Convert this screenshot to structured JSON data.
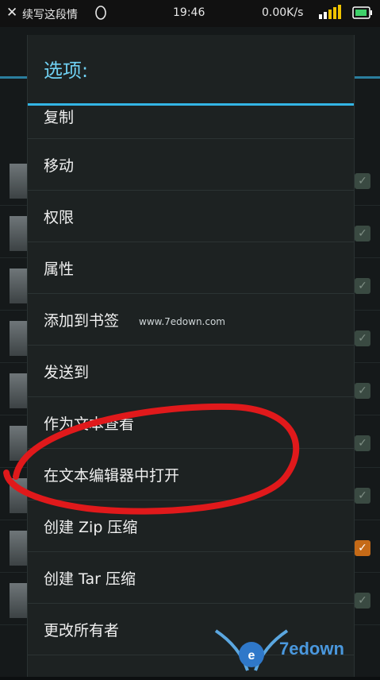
{
  "status_bar": {
    "notification_text": "续写这段情",
    "time": "19:46",
    "speed": "0.00K/s"
  },
  "dialog": {
    "title": "选项:",
    "items": [
      {
        "label": "复制"
      },
      {
        "label": "移动"
      },
      {
        "label": "权限"
      },
      {
        "label": "属性"
      },
      {
        "label": "添加到书签"
      },
      {
        "label": "发送到"
      },
      {
        "label": "作为文本查看"
      },
      {
        "label": "在文本编辑器中打开"
      },
      {
        "label": "创建 Zip 压缩"
      },
      {
        "label": "创建 Tar 压缩"
      },
      {
        "label": "更改所有者"
      }
    ]
  },
  "watermark_text": "www.7edown.com",
  "logo_text": "7edown",
  "colors": {
    "accent": "#33b5e5",
    "highlight_circle": "#e0191b",
    "dialog_bg": "#1d2222"
  }
}
